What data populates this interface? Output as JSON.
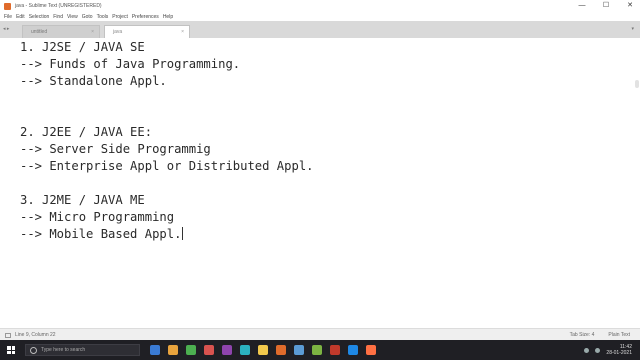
{
  "window": {
    "title": "java - Sublime Text (UNREGISTERED)",
    "controls": {
      "minimize": "—",
      "maximize": "☐",
      "close": "✕"
    }
  },
  "menu": [
    "File",
    "Edit",
    "Selection",
    "Find",
    "View",
    "Goto",
    "Tools",
    "Project",
    "Preferences",
    "Help"
  ],
  "tabs": {
    "nav": "◂ ▸",
    "inactive_label": "untitled",
    "active_label": "java",
    "close": "×",
    "dropdown": "▾"
  },
  "editor": {
    "lines": [
      "1. J2SE / JAVA SE",
      "--> Funds of Java Programming.",
      "--> Standalone Appl.",
      "2. J2EE / JAVA EE:",
      "--> Server Side Programmig",
      "--> Enterprise Appl or Distributed Appl.",
      "3. J2ME / JAVA ME",
      "--> Micro Programming",
      "--> Mobile Based Appl."
    ]
  },
  "status": {
    "left": "Line 9, Column 22",
    "right": [
      "Tab Size: 4",
      "Plain Text"
    ]
  },
  "taskbar": {
    "search_placeholder": "Type here to search",
    "app_colors": [
      "#3a7bd5",
      "#e8a33d",
      "#4caf50",
      "#d9534f",
      "#8e44ad",
      "#2bb3c0",
      "#f2c94c",
      "#e06b2b",
      "#5b9bd5",
      "#7cb342",
      "#c0392b",
      "#1e88e5",
      "#ff7043"
    ],
    "time": "11:42",
    "date": "28-01-2021"
  },
  "colors": {
    "editor_bg": "#ffffff",
    "text": "#2a2a2a",
    "tabbar_bg": "#d9d9d9",
    "taskbar_bg": "#1f1f24"
  }
}
